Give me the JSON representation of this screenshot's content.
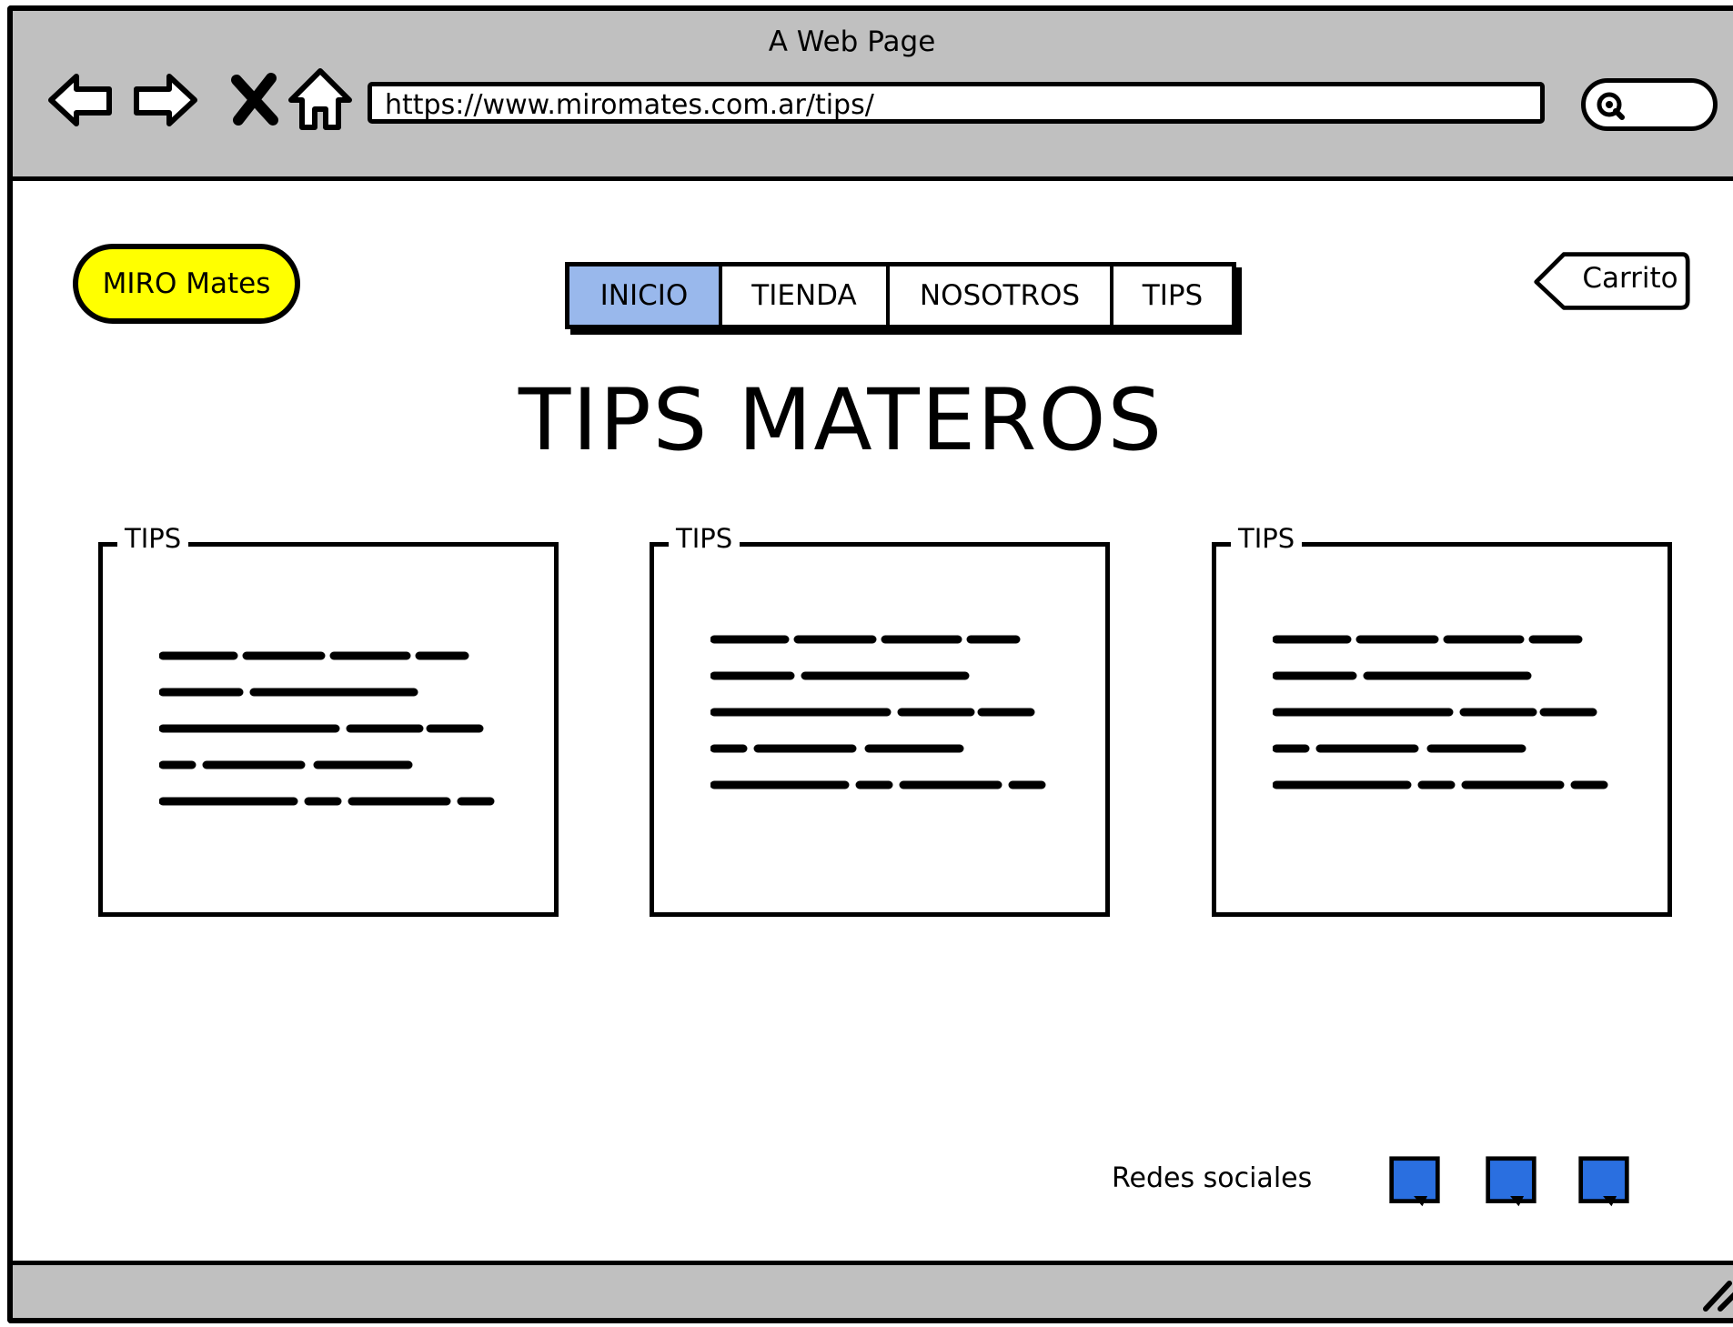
{
  "window": {
    "title": "A Web Page",
    "url": "https://www.miromates.com.ar/tips/"
  },
  "header": {
    "logo": "MIRO Mates",
    "menu": [
      {
        "label": "INICIO",
        "active": true
      },
      {
        "label": "TIENDA",
        "active": false
      },
      {
        "label": "NOSOTROS",
        "active": false
      },
      {
        "label": "TIPS",
        "active": false
      }
    ],
    "cart_label": "Carrito"
  },
  "main": {
    "title": "TIPS MATEROS",
    "cards": [
      {
        "legend": "TIPS"
      },
      {
        "legend": "TIPS"
      },
      {
        "legend": "TIPS"
      }
    ]
  },
  "footer": {
    "social_label": "Redes sociales",
    "social_icons": [
      "social-icon",
      "social-icon",
      "social-icon"
    ]
  },
  "colors": {
    "chrome": "#c0c0c0",
    "logo_bg": "#ffff00",
    "menu_active": "#99b8ec",
    "social_blue": "#2a6fe0"
  }
}
